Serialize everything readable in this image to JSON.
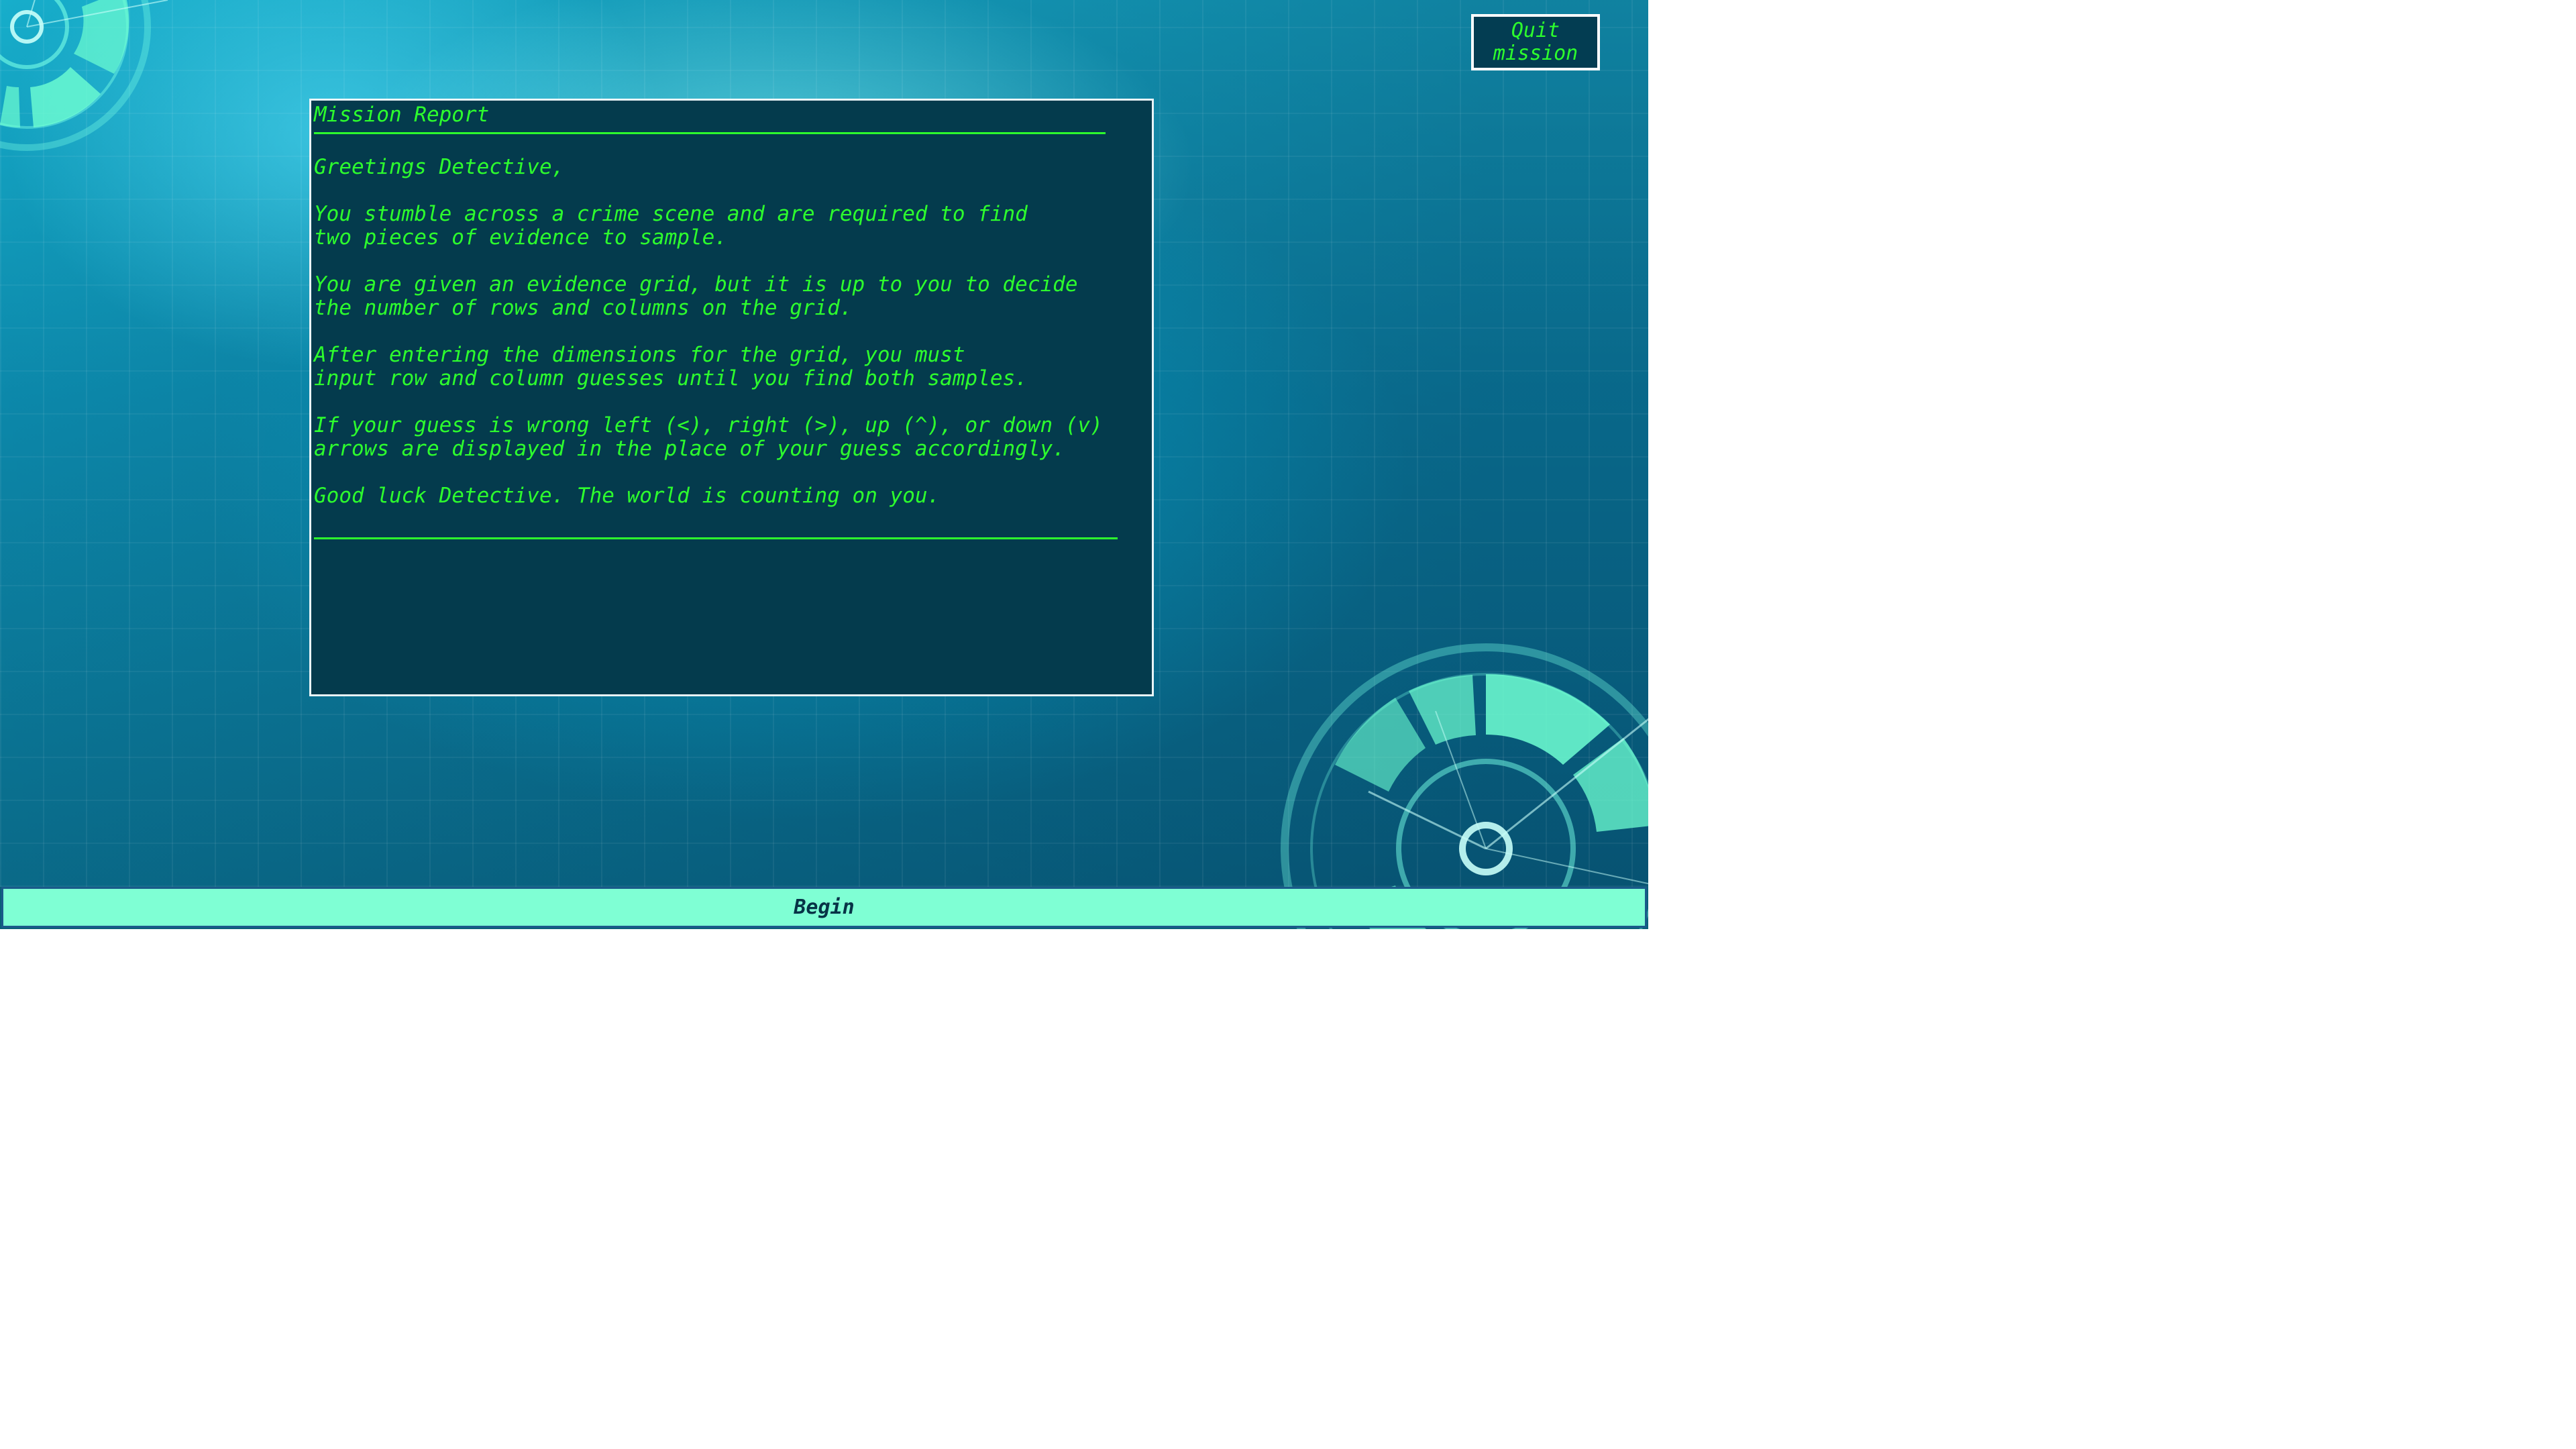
{
  "quit_button": {
    "label": "Quit\nmission"
  },
  "report": {
    "title": "Mission Report",
    "paragraphs": [
      "Greetings Detective,",
      "You stumble across a crime scene and are required to find\ntwo pieces of evidence to sample.",
      "You are given an evidence grid, but it is up to you to decide\nthe number of rows and columns on the grid.",
      "After entering the dimensions for the grid, you must\ninput row and column guesses until you find both samples.",
      "If your guess is wrong left (<), right (>), up (^), or down (v)\narrows are displayed in the place of your guess accordingly.",
      "Good luck Detective. The world is counting on you."
    ]
  },
  "begin_button": {
    "label": "Begin"
  },
  "colors": {
    "text_green": "#2dff2d",
    "panel_bg": "#043b4d",
    "begin_bg": "#7fffd4"
  }
}
